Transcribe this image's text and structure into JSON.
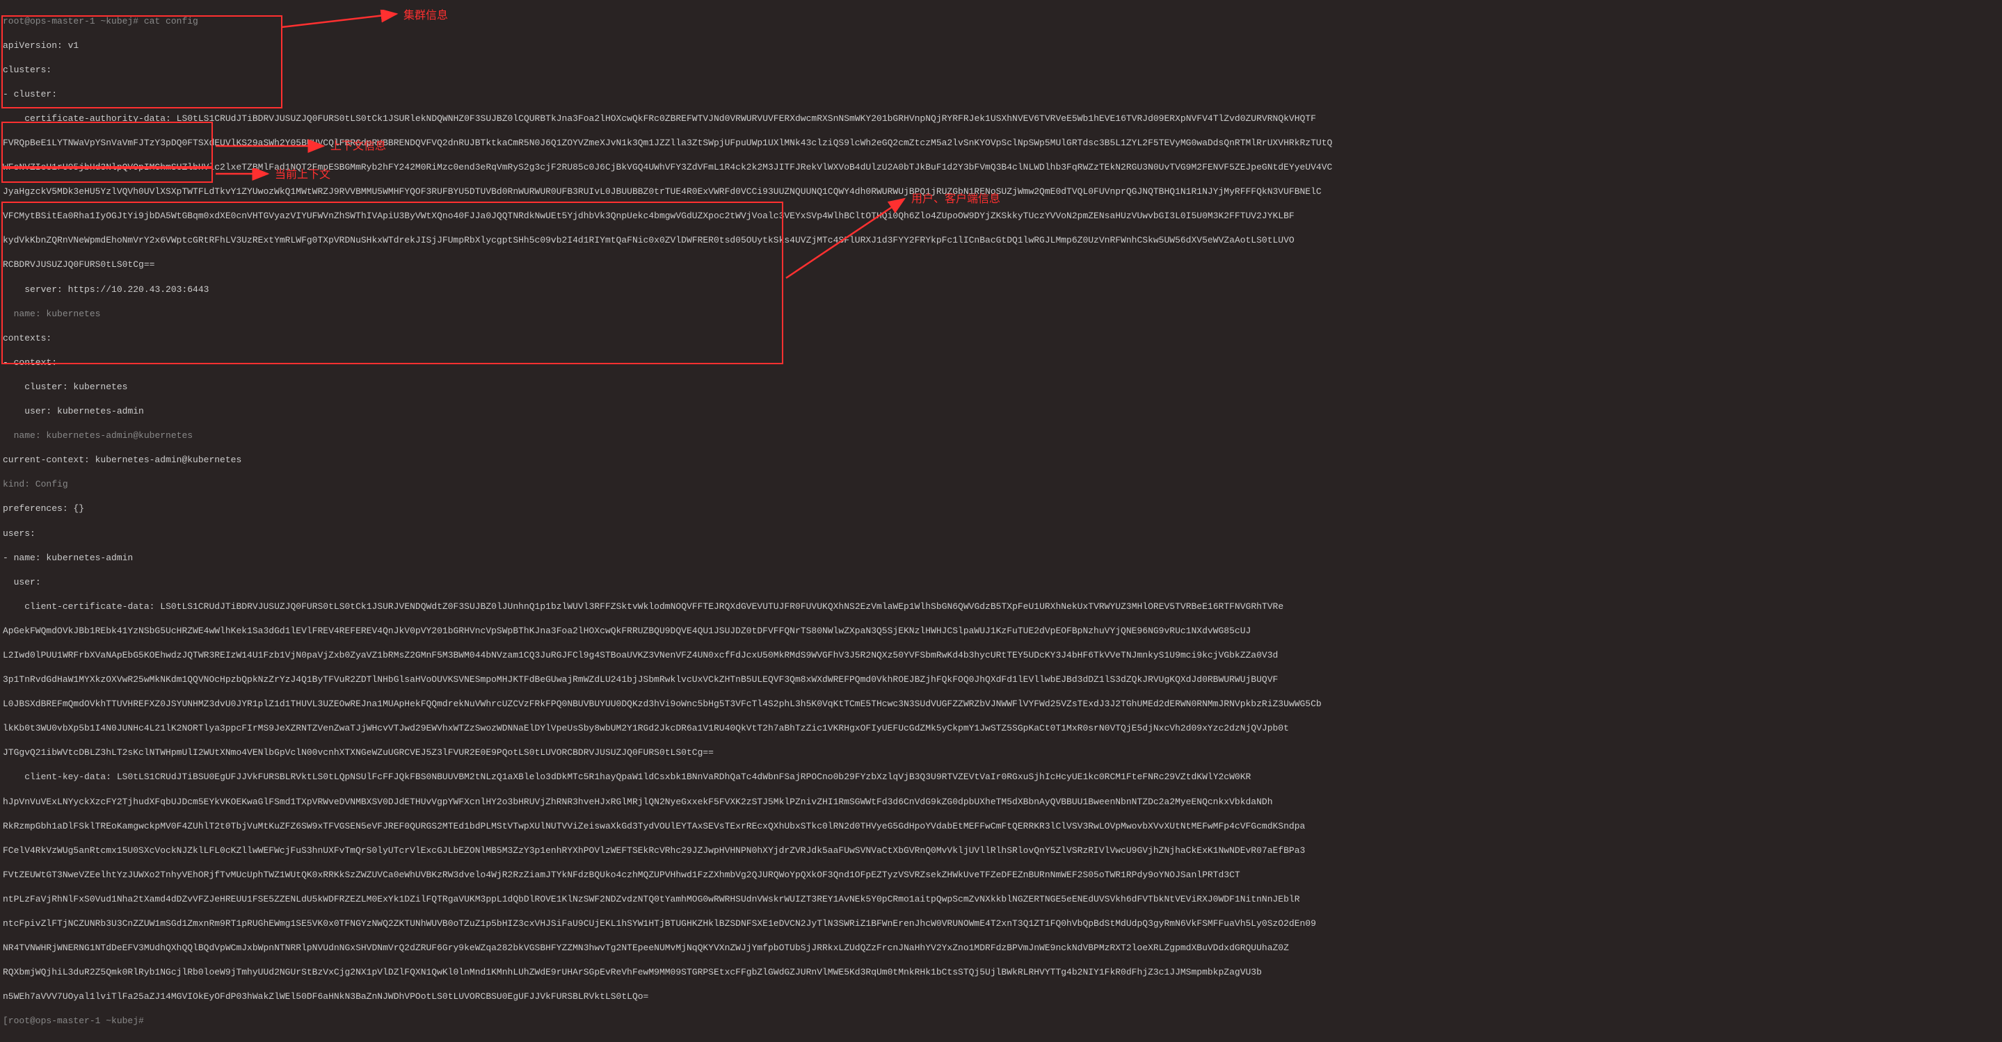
{
  "prompt_line": "root@ops-master-1 ~kubej# cat config",
  "lines": {
    "apiVersion": "apiVersion: v1",
    "clusters_key": "clusters:",
    "cluster_item": "- cluster:",
    "cad_key": "    certificate-authority-data: ",
    "cad_val": "LS0tLS1CRUdJTiBDRVJUSUZJQ0FURS0tLS0tCk1JSURlekNDQWNHZ0F3SUJBZ0lCQURBTkJna3Foa2lHOXcwQkFRc0ZBREFWTVJNd0VRWURVUVFERXdwcmRXSnNSmWKY201bGRHVnpNQjRYRFRJek1USXhNVEV6TVRVeE5Wb1hEVE16TVRJd09ERXpNVFV4TlZvd0ZURVRNQkVHQTF",
    "cad_wrap1": "FVRQpBeE1LYTNWaVpYSnVaVmFJTzY3pDQ0FTSXdEUVlKS29aSWh2Y05BUUVCQlFBRGdpRVBBRENDQVFVQ2dnRUJBTktkaCmR5N0J6Q1ZOYVZmeXJvN1k3Qm1JZZlla3ZtSWpjUFpuUWp1UXlMNk43clziQS9lcWh2eGQ2cmZtczM5a2lvSnKYOVpSclNpSWp5MUlGRTdsc3B5L1ZYL2F5TEVyMG0waDdsQnRTMlRrUXVHRkRzTUtQ",
    "cad_wrap2": "WFsNVZIeU1rU05jbHd3NlpQVOpIMGhmSUZlbHVlc2lxeTZBMlFad1NQT2FmpESBGMmRyb2hFY242M0RiMzc0end3eRqVmRyS2g3cjF2RU85c0J6CjBkVGQ4UWhVFY3ZdVFmL1R4ck2k2M3JITFJRekVlWXVoB4dUlzU2A0bTJkBuF1d2Y3bFVmQ3B4clNLWDlhb3FqRWZzTEkN2RGU3N0UvTVG9M2FENVF5ZEJpeGNtdEYyeUV4VC",
    "cad_wrap3": "JyaHgzckV5MDk3eHU5YzlVQVh0UVlXSXpTWTFLdTkvY1ZYUwozWkQ1MWtWRZJ9RVVBMMU5WMHFYQOF3RUFBYU5DTUVBd0RnWURWUR0UFB3RUIvL0JBUUBBZ0trTUE4R0ExVWRFd0VCCi93UUZNQUUNQ1CQWY4dh0RWURWUjBPQ1jRUZGbN1RENoSUZjWmw2QmE0dTVQL0FUVnprQGJNQTBHQ1N1R1NJYjMyRFFFQkN3VUFBNElC",
    "cad_wrap4": "VFCMytBSitEa0Rha1IyOGJtYi9jbDA5WtGBqm0xdXE0cnVHTGVyazVIYUFWVnZhSWThIVApiU3ByVWtXQno40FJJa0JQQTNRdkNwUEt5YjdhbVk3QnpUekc4bmgwVGdUZXpoc2tWVjVoalc3VEYxSVp4WlhBCltOTHQi0Qh6Zlo4ZUpoOW9DYjZKSkkyTUczYVVoN2pmZENsaHUzVUwvbGI3L0I5U0M3K2FFTUV2JYKLBF",
    "cad_wrap5": "kydVkKbnZQRnVNeWpmdEhoNmVrY2x6VWptcGRtRFhLV3UzRExtYmRLWFg0TXpVRDNuSHkxWTdrekJISjJFUmpRbXlycgptSHh5c09vb2I4d1RIYmtQaFNic0x0ZVlDWFRER0tsd05OUytkSks4UVZjMTc4SFlURXJ1d3FYY2FRYkpFc1lICnBacGtDQ1lwRGJLMmp6Z0UzVnRFWnhCSkw5UW56dXV5eWVZaAotLS0tLUVO",
    "cad_wrap6": "RCBDRVJUSUZJQ0FURS0tLS0tCg==",
    "server": "    server: https://10.220.43.203:6443",
    "name_kub": "  name: kubernetes",
    "contexts_key": "contexts:",
    "context_item": "- context:",
    "ctx_cluster": "    cluster: kubernetes",
    "ctx_user": "    user: kubernetes-admin",
    "ctx_name": "  name: kubernetes-admin@kubernetes",
    "current_ctx": "current-context: kubernetes-admin@kubernetes",
    "kind": "kind: Config",
    "prefs": "preferences: {}",
    "users_key": "users:",
    "user_name": "- name: kubernetes-admin",
    "user_key": "  user:",
    "ccd_key": "    client-certificate-data: ",
    "ccd_val": "LS0tLS1CRUdJTiBDRVJUSUZJQ0FURS0tLS0tCk1JSURJVENDQWdtZ0F3SUJBZ0lJUnhnQ1p1bzlWUVl3RFFZSktvWklodmNOQVFFTEJRQXdGVEVUTUJFR0FUVUKQXhNS2EzVmlaWEp1WlhSbGN6QWVGdzB5TXpFeU1URXhNekUxTVRWYUZ3MHlOREV5TVRBeE16RTFNVGRhTVRe",
    "ccd_wrap1": "ApGekFWQmdOVkJBb1REbk41YzNSbG5UcHRZWE4wWlhKek1Sa3dGd1lEVlFREV4REFEREV4QnJkV0pVY201bGRHVncVpSWpBThKJna3Foa2lHOXcwQkFRRUZBQU9DQVE4QU1JSUJDZ0tDFVFFQNrTS80NWlwZXpaN3Q5SjEKNzlHWHJCSlpaWUJ1KzFuTUE2dVpEOFBpNzhuVYjQNE96NG9vRUc1NXdvWG85cUJ",
    "ccd_wrap2": "L2Iwd0lPUU1WRFrbXVaNApEbG5KOEhwdzJQTWR3REIzW14U1Fzb1VjN0paVjZxb0ZyaVZ1bRMsZ2GMnF5M3BWM044bNVzam1CQ3JuRGJFCl9g4STBoaUVKZ3VNenVFZ4UN0xcfFdJcxU50MkRMdS9WVGFhV3J5R2NQXz50YVFSbmRwKd4b3hycURtTEY5UDcKY3J4bHF6TkVVeTNJmnkyS1U9mci9kcjVGbkZZa0V3d",
    "ccd_wrap3": "3p1TnRvdGdHaW1MYXkzOXVwR25wMkNKdm1QQVNOcHpzbQpkNzZrYzJ4Q1ByTFVuR2ZDTlNHbGlsaHVoOUVKSVNESmpoMHJKTFdBeGUwajRmWZdLU241bjJSbmRwklvcUxVCkZHTnB5ULEQVF3Qm8xWXdWREFPQmd0VkhROEJBZjhFQkFOQ0JhQXdFd1lEVllwbEJBd3dDZ1lS3dZQkJRVUgKQXdJd0RBWURWUjBUQVF",
    "ccd_wrap4": "L0JBSXdBREFmQmdOVkhTTUVHREFXZ0JSYUNHMZ3dvU0JYR1plZ1d1THUVL3UZEOwREJna1MUApHekFQQmdrekNuVWhrcUZCVzFRkFPQ0NBUVBUYUU0DQKzd3hVi9oWnc5bHg5T3VFcTl4S2phL3h5K0VqKtTCmE5THcwc3N3SUdVUGFZZWRZbVJNWWFlVYFWd25VZsTExdJ3J2TGhUMEd2dERWN0RNMmJRNVpkbzRiZ3UwWG5Cb",
    "ccd_wrap5": "lkKb0t3WU0vbXp5b1I4N0JUNHc4L21lK2NORTlya3ppcFIrMS9JeXZRNTZVenZwaTJjWHcvVTJwd29EWVhxWTZzSwozWDNNaElDYlVpeUsSby8wbUM2Y1RGd2JkcDR6a1V1RU40QkVtT2h7aBhTzZic1VKRHgxOFIyUEFUcGdZMk5yCkpmY1JwSTZ5SGpKaCt0T1MxR0srN0VTQjE5djNxcVh2d09xYzc2dzNjQVJpb0t",
    "ccd_wrap6": "JTGgvQ21ibWVtcDBLZ3hLT2sKclNTWHpmUlI2WUtXNmo4VENlbGpVclN00vcnhXTXNGeWZuUGRCVEJ5Z3lFVUR2E0E9PQotLS0tLUVORCBDRVJUSUZJQ0FURS0tLS0tCg==",
    "ckd_key": "    client-key-data: ",
    "ckd_val": "LS0tLS1CRUdJTiBSU0EgUFJJVkFURSBLRVktLS0tLQpNSUlFcFFJQkFBS0NBUUVBM2tNLzQ1aXBlelo3dDkMTc5R1hayQpaW1ldCsxbk1BNnVaRDhQaTc4dWbnFSajRPOCno0b29FYzbXzlqVjB3Q3U9RTVZEVtVaIr0RGxuSjhIcHcyUE1kc0RCM1FteFNRc29VZtdKWlY2cW0KR",
    "ckd_wrap1": "hJpVnVuVExLNYyckXzcFY2TjhudXFqbUJDcm5EYkVKOEKwaGlFSmd1TXpVRWveDVNMBXSV0DJdETHUvVgpYWFXcnlHY2o3bHRUVjZhRNR3hveHJxRGlMRjlQN2NyeGxxekF5FVXK2zSTJ5MklPZnivZHI1RmSGWWtFd3d6CnVdG9kZG0dpbUXheTM5dXBbnAyQVBBUU1BweenNbnNTZDc2a2MyeENQcnkxVbkdaNDh",
    "ckd_wrap2": "RkRzmpGbh1aDlFSklTREoKamgwckpMV0F4ZUhlT2t0TbjVuMtKuZFZ6SW9xTFVGSEN5eVFJREF0QURGS2MTEd1bdPLMStVTwpXUlNUTVViZeiswaXkGd3TydVOUlEYTAxSEVsTExrREcxQXhUbxSTkc0lRN2d0THVyeG5GdHpoYVdabEtMEFFwCmFtQERRKR3lClVSV3RwLOVpMwovbXVvXUtNtMEFwMFp4cVFGcmdKSndpa",
    "ckd_wrap3": "FCelV4RkVzWUg5anRtcmx15U0SXcVockNJZklLFL0cKZllwWEFWcjFuS3hnUXFvTmQrS0lyUTcrVlExcGJLbEZONlMB5M3ZzY3p1enhRYXhPOVlzWEFTSEkRcVRhc29JZJwpHVHNPN0hXYjdrZVRJdk5aaFUwSVNVaCtXbGVRnQ0MvVkljUVllRlhSRlovQnY5ZlVSRzRIVlVwcU9GVjhZNjhaCkExK1NwNDEvR07aEfBPa3",
    "ckd_wrap4": "FVtZEUWtGT3NweVZEelhtYzJUWXo2TnhyVEhORjfTvMUcUphTWZ1WUtQK0xRRKkSzZWZUVCa0eWhUVBKzRW3dvelo4WjR2RzZiamJTYkNFdzBQUko4czhMQZUPVHhwd1FzZXhmbVg2QJURQWoYpQXkOF3Qnd1OFpEZTyzVSVRZsekZHWkUveTFZeDFEZnBURnNmWEF2S05oTWR1RPdy9oYNOJSanlPRTd3CT",
    "ckd_wrap5": "ntPLzFaVjRhNlFxS0Vud1Nha2tXamd4dDZvVFZJeHREUU1FSE5ZZENLdU5kWDFRZEZLM0ExYk1DZilFQTRgaVUKM3ppL1dQbDlROVE1KlNzSWF2NDZvdzNTQ0tYamhMOG0wRWRHSUdnVWskrWUIZT3REY1AvNEk5Y0pCRmo1aitpQwpScmZvNXkkblNGZERTNGE5eENEdUVSVkh6dFVTbkNtVEViRXJ0WDF1NitnNnJEblR",
    "ckd_wrap6": "ntcFpivZlFTjNCZUNRb3U3CnZZUW1mSGd1ZmxnRm9RT1pRUGhEWmg1SE5VK0x0TFNGYzNWQ2ZKTUNhWUVB0oTZuZ1p5bHIZ3cxVHJSiFaU9CUjEKL1hSYW1HTjBTUGHKZHklBZSDNFSXE1eDVCN2JyTlN3SWRiZ1BFWnErenJhcW0VRUNOWmE4T2xnT3Q1ZT1FQ0hVbQpBdStMdUdpQ3gyRmN6VkFSMFFuaVh5Ly0SzO2dEn09",
    "ckd_wrap7": "NR4TVNWHRjWNERNG1NTdDeEFV3MUdhQXhQQlBQdVpWCmJxbWpnNTNRRlpNVUdnNGxSHVDNmVrQ2dZRUF6Gry9keWZqa282bkVGSBHFYZZMN3hwvTg2NTEpeeNUMvMjNqQKYVXnZWJjYmfpbOTUbSjJRRkxLZUdQZzFrcnJNaHhYV2YxZno1MDRFdzBPVmJnWE9nckNdVBPMzRXT2loeXRLZgpmdXBuVDdxdGRQUUhaZ0Z",
    "ckd_wrap8": "RQXbmjWQjhiL3duR2Z5Qmk0RlRyb1NGcjlRb0loeW9jTmhyUUd2NGUrStBzVxCjg2NX1pVlDZlFQXN1QwKl0lnMnd1KMnhLUhZWdE9rUHArSGpEvReVhFewM9MM09STGRPSEtxcFFgbZlGWdGZJURnVlMWE5Kd3RqUm0tMnkRHk1bCtsSTQj5UjlBWkRLRHVYTTg4b2NIY1FkR0dFhjZ3c1JJMSmpmbkpZagVU3b",
    "ckd_wrap9": "n5WEh7aVVV7UOyal1lviTlFa25aZJ14MGVIOkEyOFdP03hWakZlWEl50DF6aHNkN3BaZnNJWDhVPOotLS0tLUVORCBSU0EgUFJJVkFURSBLRVktLS0tLQo=",
    "final_prompt": "[root@ops-master-1 ~kubej# "
  },
  "annotations": {
    "cluster_info": "集群信息",
    "context_info": "上下文信息",
    "current_ctx": "当前上下文",
    "user_info": "用户、客户端信息"
  }
}
